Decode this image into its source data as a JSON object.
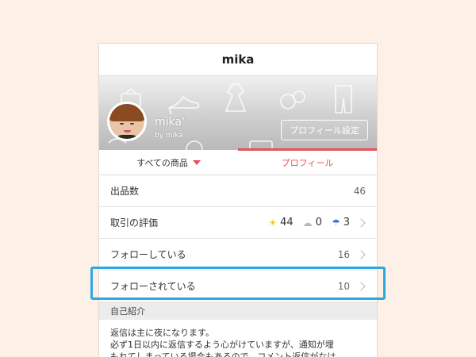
{
  "navbar": {
    "title": "mika"
  },
  "profile": {
    "display_name": "mika'",
    "byline": "by mika",
    "settings_button": "プロフィール設定"
  },
  "tabs": [
    {
      "label": "すべての商品",
      "active": false
    },
    {
      "label": "プロフィール",
      "active": true
    }
  ],
  "stats": {
    "listings": {
      "label": "出品数",
      "value": "46"
    },
    "reviews": {
      "label": "取引の評価",
      "good": "44",
      "normal": "0",
      "bad": "3",
      "icons": {
        "good": "sun-icon",
        "normal": "cloud-icon",
        "bad": "umbrella-icon"
      }
    },
    "following": {
      "label": "フォローしている",
      "value": "16"
    },
    "followers": {
      "label": "フォローされている",
      "value": "10"
    }
  },
  "intro": {
    "header": "自己紹介",
    "lines": [
      "返信は主に夜になります。",
      "必ず1日以内に返信するよう心がけていますが、通知が埋",
      "もれてしまっている場合もあるので、コメント返信がなけ"
    ]
  },
  "colors": {
    "accent": "#e8505b",
    "highlight": "#2ea7e0",
    "background": "#fdf0e6"
  }
}
